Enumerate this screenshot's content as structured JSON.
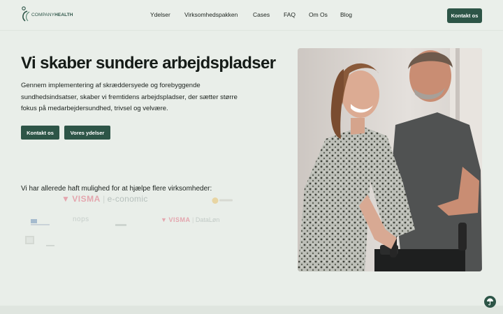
{
  "header": {
    "logo_text_a": "COMPANY",
    "logo_text_b": "HEALTH",
    "nav": [
      "Ydelser",
      "Virksomhedspakken",
      "Cases",
      "FAQ",
      "Om Os",
      "Blog"
    ],
    "cta_label": "Kontakt os"
  },
  "hero": {
    "title": "Vi skaber sundere arbejdspladser",
    "body": "Gennem implementering af skræddersyede og forebyggende sundhedsindsatser, skaber vi fremtidens arbejdspladser, der sætter større fokus på medarbejdersundhed, trivsel og velvære.",
    "buttons": {
      "contact": "Kontakt os",
      "services": "Vores ydelser"
    },
    "clients_heading": "Vi har allerede haft mulighed for at hjælpe flere virksomheder:"
  },
  "clients": {
    "visma_1": "VISMA",
    "economic": "e-conomic",
    "visma_2": "VISMA",
    "dataloen": "DataLøn",
    "nops": "nops"
  },
  "colors": {
    "brand_green": "#2d5547",
    "background": "#e9eee9",
    "visma_pink": "#e06c7f"
  },
  "icons": {
    "logo": "company-health-logo-icon",
    "float": "umbrella-icon"
  }
}
